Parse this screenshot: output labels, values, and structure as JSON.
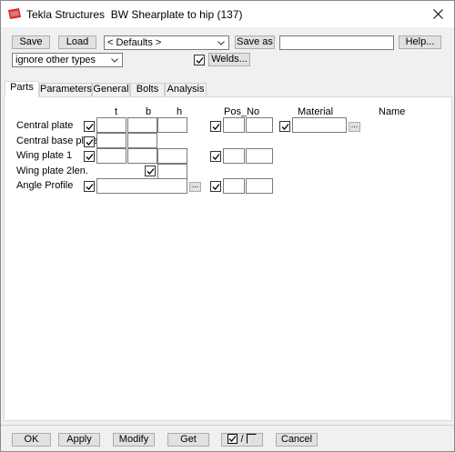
{
  "window": {
    "app": "Tekla Structures",
    "title": "BW Shearplate to hip (137)"
  },
  "toolbar": {
    "save_label": "Save",
    "load_label": "Load",
    "preset_value": "< Defaults >",
    "saveas_label": "Save as",
    "saveas_value": "",
    "help_label": "Help...",
    "filter_value": "ignore other types",
    "welds_label": "Welds..."
  },
  "tabs": [
    {
      "label": "Parts"
    },
    {
      "label": "Parameters"
    },
    {
      "label": "General"
    },
    {
      "label": "Bolts"
    },
    {
      "label": "Analysis"
    }
  ],
  "parts": {
    "headers": {
      "t": "t",
      "b": "b",
      "h": "h",
      "pos": "Pos_No",
      "material": "Material",
      "name": "Name"
    },
    "rows": [
      {
        "label": "Central plate"
      },
      {
        "label": "Central base plate"
      },
      {
        "label": "Wing plate 1"
      },
      {
        "label": "Wing plate 2len."
      },
      {
        "label": "Angle Profile"
      }
    ],
    "browse_label": "..."
  },
  "bottom": {
    "ok_label": "OK",
    "apply_label": "Apply",
    "modify_label": "Modify",
    "get_label": "Get",
    "toggle_sep": "/",
    "cancel_label": "Cancel"
  },
  "colors": {
    "window_bg": "#f0f0f0",
    "panel_bg": "#ffffff",
    "button_bg": "#e1e1e1",
    "icon_red": "#d62b2b"
  }
}
